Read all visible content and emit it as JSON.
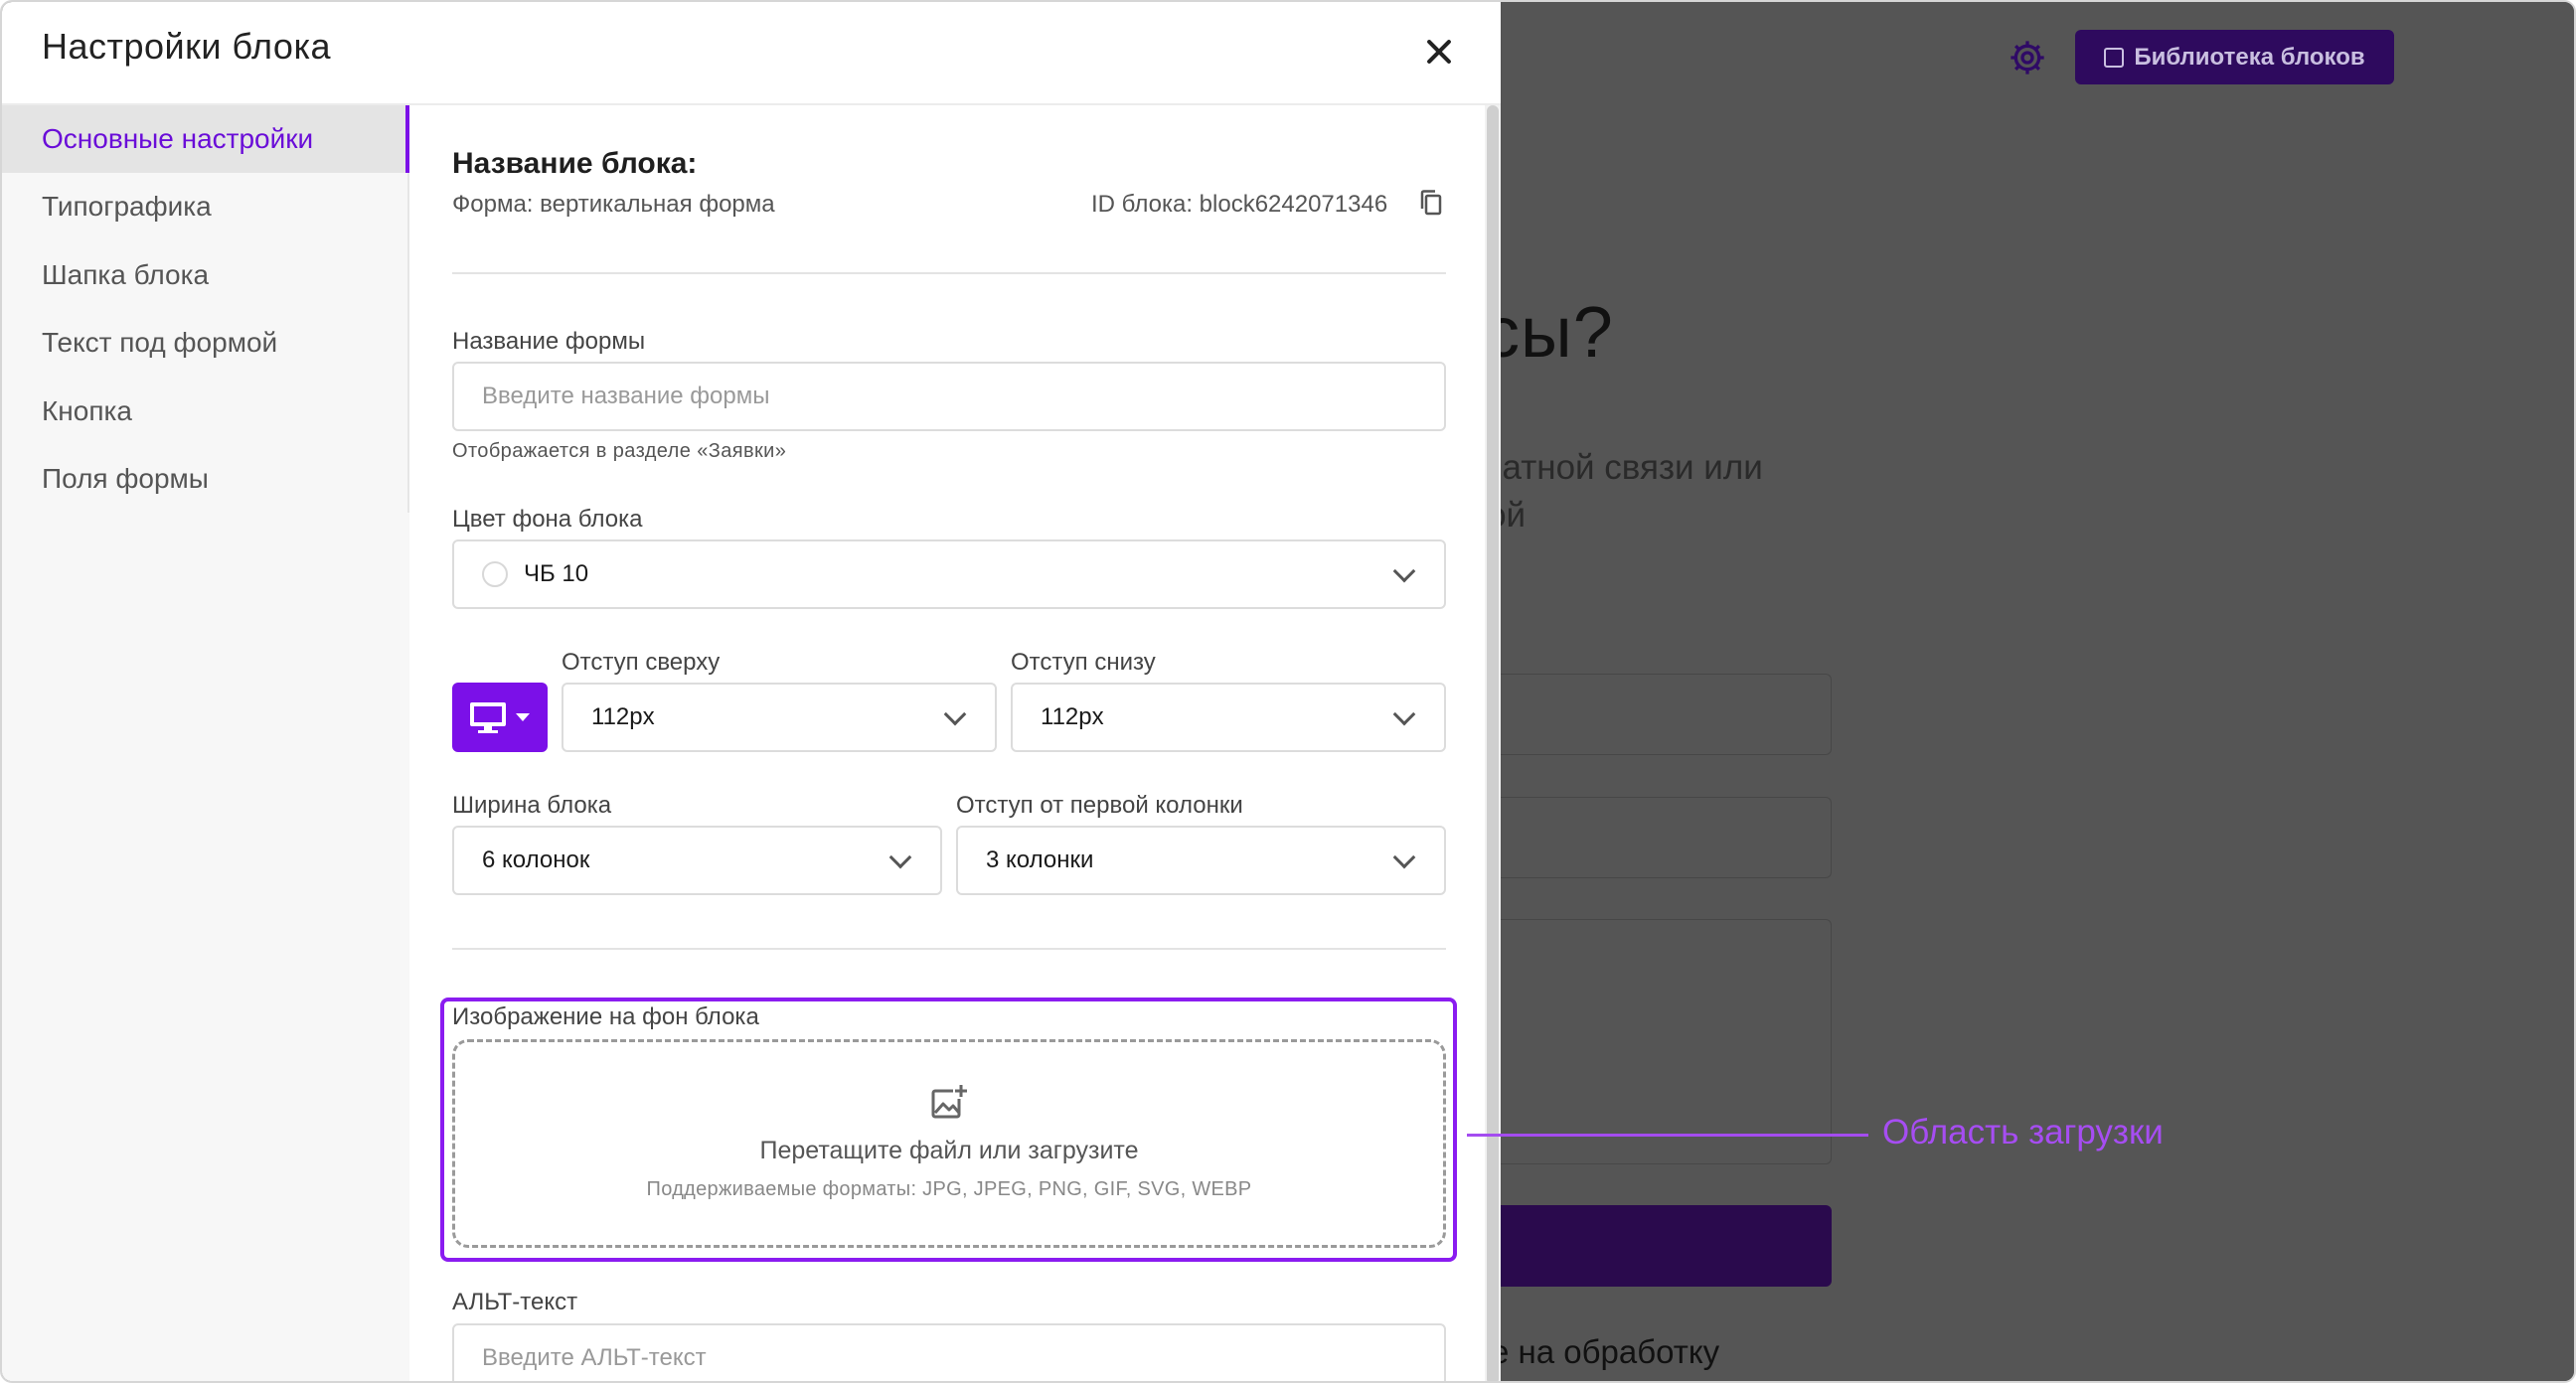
{
  "background": {
    "library_button_label": "Библиотека блоков",
    "heading_fragment": "осы?",
    "subtitle_fragment": "братной связи или\nмой",
    "consent_fragment": "е на обработку"
  },
  "modal": {
    "title": "Настройки блока",
    "sidebar": {
      "items": [
        {
          "label": "Основные настройки",
          "active": true
        },
        {
          "label": "Типографика"
        },
        {
          "label": "Шапка блока"
        },
        {
          "label": "Текст под формой"
        },
        {
          "label": "Кнопка"
        },
        {
          "label": "Поля формы"
        }
      ]
    },
    "block_name_label": "Название блока:",
    "form_type": "Форма: вертикальная форма",
    "block_id": "ID блока: block6242071346",
    "form_name": {
      "label": "Название формы",
      "placeholder": "Введите название формы",
      "hint": "Отображается в разделе «Заявки»"
    },
    "bg_color": {
      "label": "Цвет фона блока",
      "value": "ЧБ 10"
    },
    "padding_top": {
      "label": "Отступ сверху",
      "value": "112px"
    },
    "padding_bottom": {
      "label": "Отступ снизу",
      "value": "112px"
    },
    "block_width": {
      "label": "Ширина блока",
      "value": "6 колонок"
    },
    "first_column_offset": {
      "label": "Отступ от первой колонки",
      "value": "3 колонки"
    },
    "bg_image": {
      "label": "Изображение на фон блока",
      "drop_title": "Перетащите файл или загрузите",
      "drop_formats": "Поддерживаемые форматы: JPG, JPEG, PNG, GIF, SVG, WEBP"
    },
    "alt_text": {
      "label": "АЛЬТ-текст",
      "placeholder": "Введите АЛЬТ-текст"
    }
  },
  "callout": {
    "label": "Область загрузки"
  },
  "colors": {
    "accent": "#7b10e8",
    "overlay": "#555555",
    "callout": "#a64df2"
  }
}
